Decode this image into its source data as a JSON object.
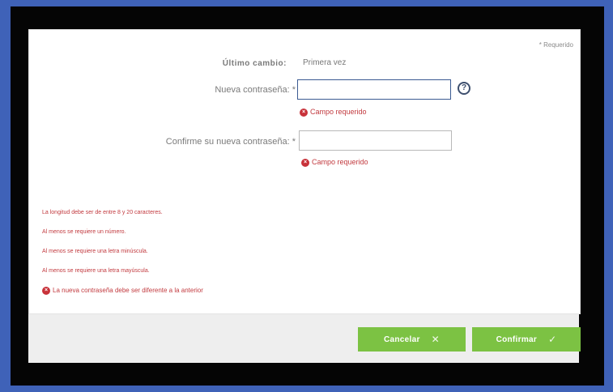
{
  "form": {
    "required_note": "* Requerido",
    "last_change_label": "Último cambio:",
    "last_change_value": "Primera vez",
    "new_password_label": "Nueva contraseña: *",
    "new_password_value": "",
    "new_password_help": "?",
    "new_password_error": "Campo requerido",
    "confirm_password_label": "Confirme su nueva contraseña: *",
    "confirm_password_value": "",
    "confirm_password_error": "Campo requerido",
    "error_glyph": "×"
  },
  "rules": [
    "La longitud debe ser de entre 8 y 20 caracteres.",
    "Al menos se requiere un número.",
    "Al menos se requiere una letra minúscula.",
    "Al menos se requiere una letra mayúscula.",
    "La nueva contraseña debe ser diferente a la anterior"
  ],
  "buttons": {
    "cancel_label": "Cancelar",
    "cancel_icon": "✕",
    "confirm_label": "Confirmar",
    "confirm_icon": "✓"
  },
  "colors": {
    "background": "#3f62b8",
    "button": "#7cc243",
    "error": "#c23a3f"
  }
}
